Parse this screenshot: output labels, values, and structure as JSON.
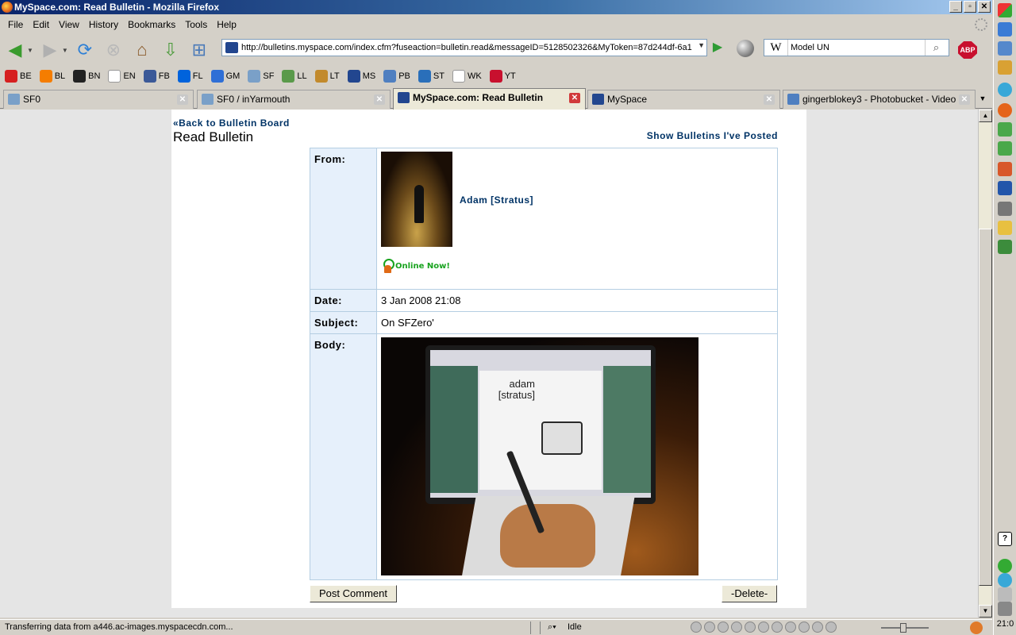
{
  "window": {
    "title": "MySpace.com: Read Bulletin - Mozilla Firefox",
    "buttons": {
      "minimize": "_",
      "maximize": "▫",
      "close": "✕"
    }
  },
  "menu": [
    "File",
    "Edit",
    "View",
    "History",
    "Bookmarks",
    "Tools",
    "Help"
  ],
  "nav": {
    "url": "http://bulletins.myspace.com/index.cfm?fuseaction=bulletin.read&messageID=5128502326&MyToken=87d244df-6a1",
    "search_engine": "W",
    "search_value": "Model UN",
    "adblock_label": "ABP"
  },
  "bookmarks": [
    {
      "label": "BE",
      "icon": "be-icon",
      "color": "#d61f1f"
    },
    {
      "label": "BL",
      "icon": "blogger-icon",
      "color": "#f57d00"
    },
    {
      "label": "BN",
      "icon": "bbc-icon",
      "color": "#222222"
    },
    {
      "label": "EN",
      "icon": "page-icon",
      "color": "#ffffff"
    },
    {
      "label": "FB",
      "icon": "facebook-icon",
      "color": "#3b5998"
    },
    {
      "label": "FL",
      "icon": "flickr-icon",
      "color": "#0063dc"
    },
    {
      "label": "GM",
      "icon": "google-icon",
      "color": "#2f6fd6"
    },
    {
      "label": "SF",
      "icon": "sf-icon",
      "color": "#7aa0c8"
    },
    {
      "label": "LL",
      "icon": "ll-icon",
      "color": "#5a9a4a"
    },
    {
      "label": "LT",
      "icon": "lt-icon",
      "color": "#c28a2c"
    },
    {
      "label": "MS",
      "icon": "myspace-icon",
      "color": "#22468f"
    },
    {
      "label": "PB",
      "icon": "photobucket-icon",
      "color": "#4f7fc0"
    },
    {
      "label": "ST",
      "icon": "st-icon",
      "color": "#2a6fba"
    },
    {
      "label": "WK",
      "icon": "page-icon",
      "color": "#ffffff"
    },
    {
      "label": "YT",
      "icon": "youtube-icon",
      "color": "#c8102e"
    }
  ],
  "tabs": [
    {
      "label": "SF0",
      "active": false
    },
    {
      "label": "SF0 / inYarmouth",
      "active": false
    },
    {
      "label": "MySpace.com: Read Bulletin",
      "active": true
    },
    {
      "label": "MySpace",
      "active": false
    },
    {
      "label": "gingerblokey3 - Photobucket - Video ...",
      "active": false
    }
  ],
  "page": {
    "back_link": "«Back to Bulletin Board",
    "title": "Read Bulletin",
    "show_posted": "Show Bulletins I've Posted",
    "labels": {
      "from": "From:",
      "date": "Date:",
      "subject": "Subject:",
      "body": "Body:"
    },
    "sender": "Adam [Stratus]",
    "online": "Online Now!",
    "date": "3 Jan 2008 21:08",
    "subject": "On SFZero'",
    "photo_screen_text": "adam [stratus]",
    "post_comment": "Post Comment",
    "delete": "-Delete-"
  },
  "status": {
    "text": "Transferring data from a446.ac-images.myspacecdn.com...",
    "idle": "Idle"
  },
  "clock": "21:0"
}
